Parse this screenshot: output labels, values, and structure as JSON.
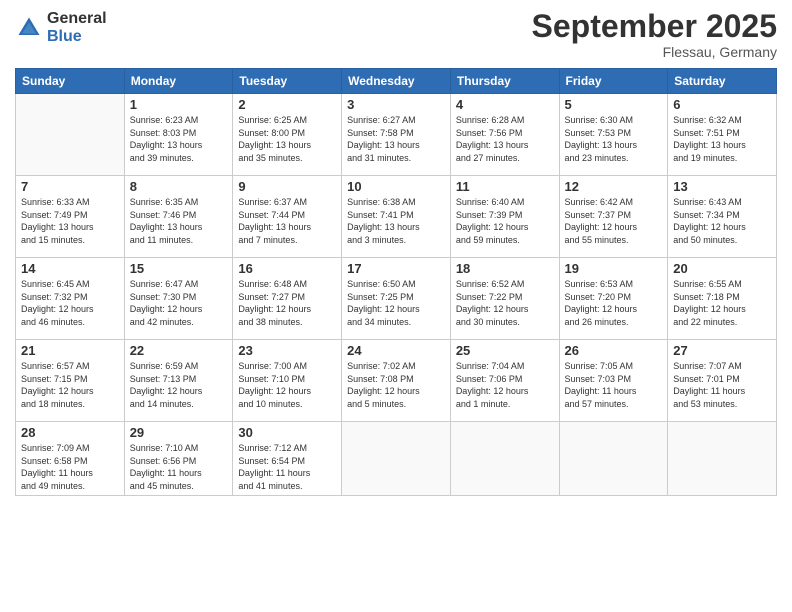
{
  "header": {
    "logo_general": "General",
    "logo_blue": "Blue",
    "month_title": "September 2025",
    "location": "Flessau, Germany"
  },
  "calendar": {
    "days_of_week": [
      "Sunday",
      "Monday",
      "Tuesday",
      "Wednesday",
      "Thursday",
      "Friday",
      "Saturday"
    ],
    "weeks": [
      [
        {
          "day": "",
          "info": ""
        },
        {
          "day": "1",
          "info": "Sunrise: 6:23 AM\nSunset: 8:03 PM\nDaylight: 13 hours\nand 39 minutes."
        },
        {
          "day": "2",
          "info": "Sunrise: 6:25 AM\nSunset: 8:00 PM\nDaylight: 13 hours\nand 35 minutes."
        },
        {
          "day": "3",
          "info": "Sunrise: 6:27 AM\nSunset: 7:58 PM\nDaylight: 13 hours\nand 31 minutes."
        },
        {
          "day": "4",
          "info": "Sunrise: 6:28 AM\nSunset: 7:56 PM\nDaylight: 13 hours\nand 27 minutes."
        },
        {
          "day": "5",
          "info": "Sunrise: 6:30 AM\nSunset: 7:53 PM\nDaylight: 13 hours\nand 23 minutes."
        },
        {
          "day": "6",
          "info": "Sunrise: 6:32 AM\nSunset: 7:51 PM\nDaylight: 13 hours\nand 19 minutes."
        }
      ],
      [
        {
          "day": "7",
          "info": "Sunrise: 6:33 AM\nSunset: 7:49 PM\nDaylight: 13 hours\nand 15 minutes."
        },
        {
          "day": "8",
          "info": "Sunrise: 6:35 AM\nSunset: 7:46 PM\nDaylight: 13 hours\nand 11 minutes."
        },
        {
          "day": "9",
          "info": "Sunrise: 6:37 AM\nSunset: 7:44 PM\nDaylight: 13 hours\nand 7 minutes."
        },
        {
          "day": "10",
          "info": "Sunrise: 6:38 AM\nSunset: 7:41 PM\nDaylight: 13 hours\nand 3 minutes."
        },
        {
          "day": "11",
          "info": "Sunrise: 6:40 AM\nSunset: 7:39 PM\nDaylight: 12 hours\nand 59 minutes."
        },
        {
          "day": "12",
          "info": "Sunrise: 6:42 AM\nSunset: 7:37 PM\nDaylight: 12 hours\nand 55 minutes."
        },
        {
          "day": "13",
          "info": "Sunrise: 6:43 AM\nSunset: 7:34 PM\nDaylight: 12 hours\nand 50 minutes."
        }
      ],
      [
        {
          "day": "14",
          "info": "Sunrise: 6:45 AM\nSunset: 7:32 PM\nDaylight: 12 hours\nand 46 minutes."
        },
        {
          "day": "15",
          "info": "Sunrise: 6:47 AM\nSunset: 7:30 PM\nDaylight: 12 hours\nand 42 minutes."
        },
        {
          "day": "16",
          "info": "Sunrise: 6:48 AM\nSunset: 7:27 PM\nDaylight: 12 hours\nand 38 minutes."
        },
        {
          "day": "17",
          "info": "Sunrise: 6:50 AM\nSunset: 7:25 PM\nDaylight: 12 hours\nand 34 minutes."
        },
        {
          "day": "18",
          "info": "Sunrise: 6:52 AM\nSunset: 7:22 PM\nDaylight: 12 hours\nand 30 minutes."
        },
        {
          "day": "19",
          "info": "Sunrise: 6:53 AM\nSunset: 7:20 PM\nDaylight: 12 hours\nand 26 minutes."
        },
        {
          "day": "20",
          "info": "Sunrise: 6:55 AM\nSunset: 7:18 PM\nDaylight: 12 hours\nand 22 minutes."
        }
      ],
      [
        {
          "day": "21",
          "info": "Sunrise: 6:57 AM\nSunset: 7:15 PM\nDaylight: 12 hours\nand 18 minutes."
        },
        {
          "day": "22",
          "info": "Sunrise: 6:59 AM\nSunset: 7:13 PM\nDaylight: 12 hours\nand 14 minutes."
        },
        {
          "day": "23",
          "info": "Sunrise: 7:00 AM\nSunset: 7:10 PM\nDaylight: 12 hours\nand 10 minutes."
        },
        {
          "day": "24",
          "info": "Sunrise: 7:02 AM\nSunset: 7:08 PM\nDaylight: 12 hours\nand 5 minutes."
        },
        {
          "day": "25",
          "info": "Sunrise: 7:04 AM\nSunset: 7:06 PM\nDaylight: 12 hours\nand 1 minute."
        },
        {
          "day": "26",
          "info": "Sunrise: 7:05 AM\nSunset: 7:03 PM\nDaylight: 11 hours\nand 57 minutes."
        },
        {
          "day": "27",
          "info": "Sunrise: 7:07 AM\nSunset: 7:01 PM\nDaylight: 11 hours\nand 53 minutes."
        }
      ],
      [
        {
          "day": "28",
          "info": "Sunrise: 7:09 AM\nSunset: 6:58 PM\nDaylight: 11 hours\nand 49 minutes."
        },
        {
          "day": "29",
          "info": "Sunrise: 7:10 AM\nSunset: 6:56 PM\nDaylight: 11 hours\nand 45 minutes."
        },
        {
          "day": "30",
          "info": "Sunrise: 7:12 AM\nSunset: 6:54 PM\nDaylight: 11 hours\nand 41 minutes."
        },
        {
          "day": "",
          "info": ""
        },
        {
          "day": "",
          "info": ""
        },
        {
          "day": "",
          "info": ""
        },
        {
          "day": "",
          "info": ""
        }
      ]
    ]
  }
}
